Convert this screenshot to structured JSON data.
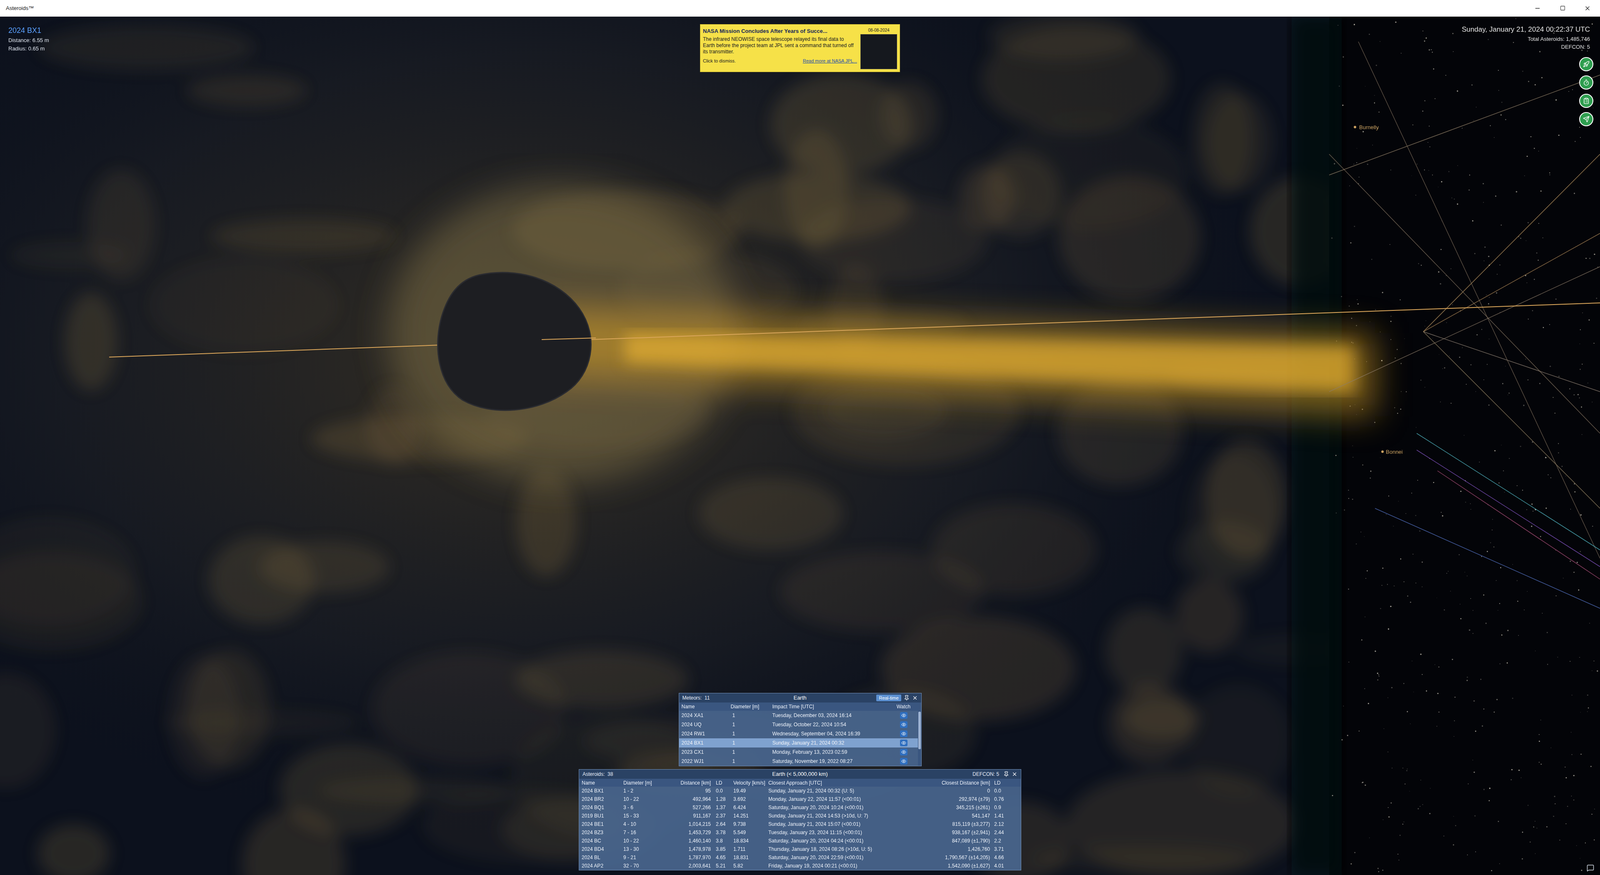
{
  "window": {
    "title": "Asteroids™"
  },
  "hud_left": {
    "name": "2024 BX1",
    "distance": "Distance: 6.55 m",
    "radius": "Radius: 0.65 m"
  },
  "hud_right": {
    "datetime": "Sunday, January 21, 2024 00:22:37 UTC",
    "total": "Total Asteroids: 1,485,746",
    "defcon": "DEFCON: 5"
  },
  "news": {
    "title": "NASA Mission Concludes After Years of Succe...",
    "date": "08-08-2024",
    "body": "The infrared NEOWISE space telescope relayed its final data to Earth before the project team at JPL sent a command that turned off its transmitter.",
    "dismiss": "Click to dismiss.",
    "link": "Read more at NASA JPL..."
  },
  "scene_labels": [
    "Burnelly",
    "Bonnei"
  ],
  "meteors_panel": {
    "count_label": "Meteors:",
    "count": "11",
    "title": "Earth",
    "mode": "Real-time",
    "columns": [
      "Name",
      "Diameter [m]",
      "Impact Time [UTC]",
      "Watch"
    ],
    "rows": [
      {
        "name": "2024 XA1",
        "diameter": "1",
        "impact": "Tuesday, December 03, 2024 16:14",
        "selected": false
      },
      {
        "name": "2024 UQ",
        "diameter": "1",
        "impact": "Tuesday, October 22, 2024 10:54",
        "selected": false
      },
      {
        "name": "2024 RW1",
        "diameter": "1",
        "impact": "Wednesday, September 04, 2024 16:39",
        "selected": false
      },
      {
        "name": "2024 BX1",
        "diameter": "1",
        "impact": "Sunday, January 21, 2024 00:32",
        "selected": true
      },
      {
        "name": "2023 CX1",
        "diameter": "1",
        "impact": "Monday, February 13, 2023 02:59",
        "selected": false
      },
      {
        "name": "2022 WJ1",
        "diameter": "1",
        "impact": "Saturday, November 19, 2022 08:27",
        "selected": false
      }
    ]
  },
  "asteroids_panel": {
    "count_label": "Asteroids:",
    "count": "38",
    "title": "Earth (< 5,000,000 km)",
    "defcon": "DEFCON: 5",
    "columns": [
      "Name",
      "Diameter [m]",
      "Distance [km]",
      "LD",
      "Velocity [km/s]",
      "Closest Approach [UTC]",
      "Closest Distance [km]",
      "LD"
    ],
    "rows": [
      {
        "name": "2024 BX1",
        "diameter": "1 - 2",
        "distance": "95",
        "ld": "0.0",
        "velocity": "19.49",
        "approach": "Sunday, January 21, 2024 00:32 (U: 5)",
        "closest": "0",
        "cld": "0.0"
      },
      {
        "name": "2024 BR2",
        "diameter": "10 - 22",
        "distance": "492,964",
        "ld": "1.28",
        "velocity": "3.692",
        "approach": "Monday, January 22, 2024 11:57 (<00:01)",
        "closest": "292,974 (±79)",
        "cld": "0.76"
      },
      {
        "name": "2024 BQ1",
        "diameter": "3 - 6",
        "distance": "527,266",
        "ld": "1.37",
        "velocity": "6.424",
        "approach": "Saturday, January 20, 2024 10:24 (<00:01)",
        "closest": "345,215 (±261)",
        "cld": "0.9"
      },
      {
        "name": "2019 BU1",
        "diameter": "15 - 33",
        "distance": "911,167",
        "ld": "2.37",
        "velocity": "14.251",
        "approach": "Sunday, January 21, 2024 14:53 (>10d, U: 7)",
        "closest": "541,147",
        "cld": "1.41"
      },
      {
        "name": "2024 BE1",
        "diameter": "4 - 10",
        "distance": "1,014,215",
        "ld": "2.64",
        "velocity": "9.738",
        "approach": "Sunday, January 21, 2024 15:07 (<00:01)",
        "closest": "815,119 (±3,277)",
        "cld": "2.12"
      },
      {
        "name": "2024 BZ3",
        "diameter": "7 - 16",
        "distance": "1,453,729",
        "ld": "3.78",
        "velocity": "5.549",
        "approach": "Tuesday, January 23, 2024 11:15 (<00:01)",
        "closest": "938,167 (±2,941)",
        "cld": "2.44"
      },
      {
        "name": "2024 BC",
        "diameter": "10 - 22",
        "distance": "1,460,140",
        "ld": "3.8",
        "velocity": "18.834",
        "approach": "Saturday, January 20, 2024 04:24 (<00:01)",
        "closest": "847,089 (±1,790)",
        "cld": "2.2"
      },
      {
        "name": "2024 BD4",
        "diameter": "13 - 30",
        "distance": "1,478,978",
        "ld": "3.85",
        "velocity": "1.711",
        "approach": "Thursday, January 18, 2024 08:26 (>10d, U: 5)",
        "closest": "1,426,760",
        "cld": "3.71"
      },
      {
        "name": "2024 BL",
        "diameter": "9 - 21",
        "distance": "1,787,970",
        "ld": "4.65",
        "velocity": "18.831",
        "approach": "Saturday, January 20, 2024 22:59 (<00:01)",
        "closest": "1,790,567 (±14,205)",
        "cld": "4.66"
      },
      {
        "name": "2024 AP2",
        "diameter": "32 - 70",
        "distance": "2,003,641",
        "ld": "5.21",
        "velocity": "5.82",
        "approach": "Friday, January 19, 2024 00:21 (<00:01)",
        "closest": "1,542,090 (±1,627)",
        "cld": "4.01"
      }
    ]
  }
}
